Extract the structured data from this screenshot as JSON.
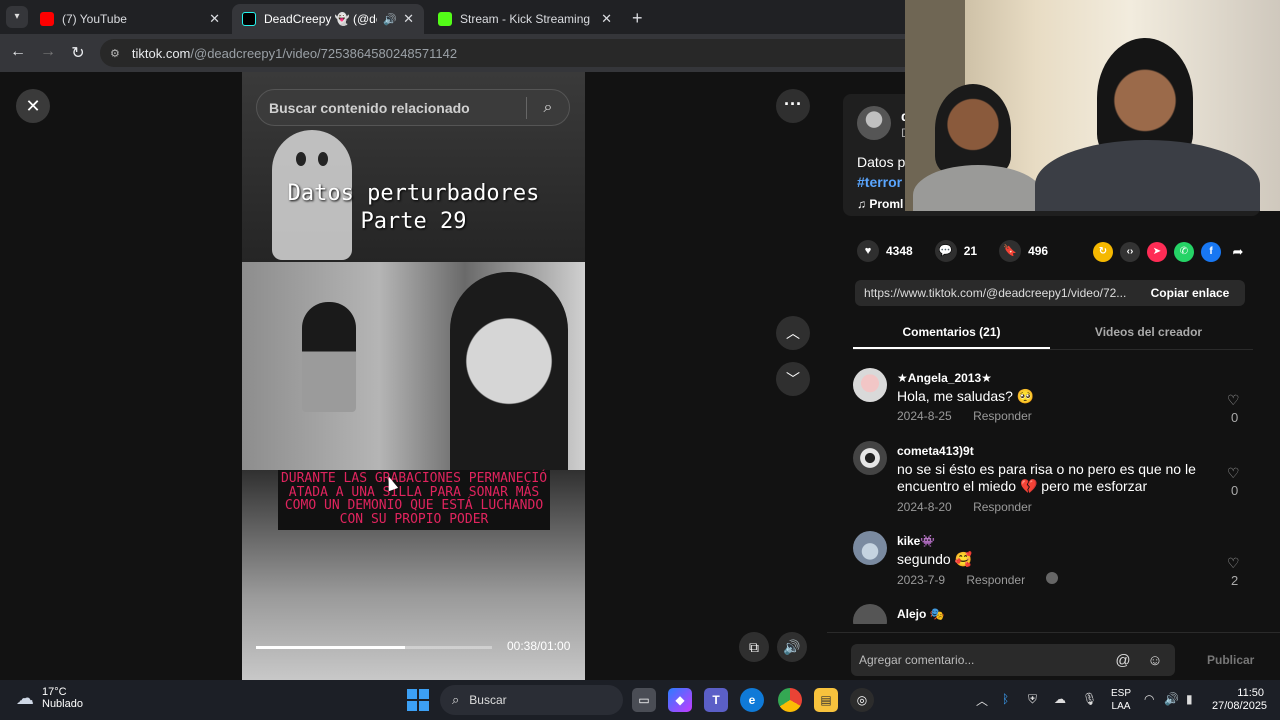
{
  "browser": {
    "tabs": [
      {
        "title": "(7) YouTube",
        "favicon_color": "#ff0000",
        "active": false
      },
      {
        "title": "DeadCreepy 👻 (@deadcre",
        "favicon_color": "#000000",
        "active": true
      },
      {
        "title": "Stream - Kick Streaming",
        "favicon_color": "#53fc18",
        "active": false
      }
    ],
    "url_domain": "tiktok.com",
    "url_path": "/@deadcreepy1/video/7253864580248571142"
  },
  "video": {
    "search_placeholder": "Buscar contenido relacionado",
    "title_line1": "Datos perturbadores",
    "title_line2": "Parte 29",
    "caption": "DURANTE LAS GRABACIONES PERMANECIÓ ATADA A UNA SILLA PARA SONAR MÁS COMO UN DEMONIO QUE ESTÁ LUCHANDO CON SU PROPIO PODER",
    "timecode": "00:38/01:00",
    "progress_fraction": 0.63
  },
  "post": {
    "author_initial": "d",
    "author_sub": "D",
    "description": "Datos p",
    "hashtag": "#terror",
    "music": "♫  Proml",
    "likes": "4348",
    "comments": "21",
    "saves": "496",
    "link": "https://www.tiktok.com/@deadcreepy1/video/72...",
    "copy_label": "Copiar enlace"
  },
  "panel_tabs": {
    "comments": "Comentarios (21)",
    "creator_videos": "Videos del creador"
  },
  "comments": [
    {
      "user": "★Angela_2013★",
      "text": "Hola, me saludas? 🥺",
      "date": "2024-8-25",
      "reply": "Responder",
      "likes": "0",
      "avatar_color": "#d9d9d9"
    },
    {
      "user": "cometa413)9t",
      "text": "no se si ésto es para risa o no pero es que no le encuentro el miedo 💔 pero me esforzar",
      "date": "2024-8-20",
      "reply": "Responder",
      "likes": "0",
      "avatar_color": "#e6e6e6"
    },
    {
      "user": "kike👾",
      "text": "segundo 🥰",
      "date": "2023-7-9",
      "reply": "Responder",
      "likes": "2",
      "avatar_color": "#7a8aa0"
    },
    {
      "user": "Alejo 🎭",
      "text": "",
      "date": "",
      "reply": "",
      "likes": "",
      "avatar_color": "#555555"
    }
  ],
  "comment_input": {
    "placeholder": "Agregar comentario...",
    "post_label": "Publicar"
  },
  "taskbar": {
    "temp": "17°C",
    "weather": "Nublado",
    "search": "Buscar",
    "lang1": "ESP",
    "lang2": "LAA",
    "time": "11:50",
    "date": "27/08/2025"
  }
}
